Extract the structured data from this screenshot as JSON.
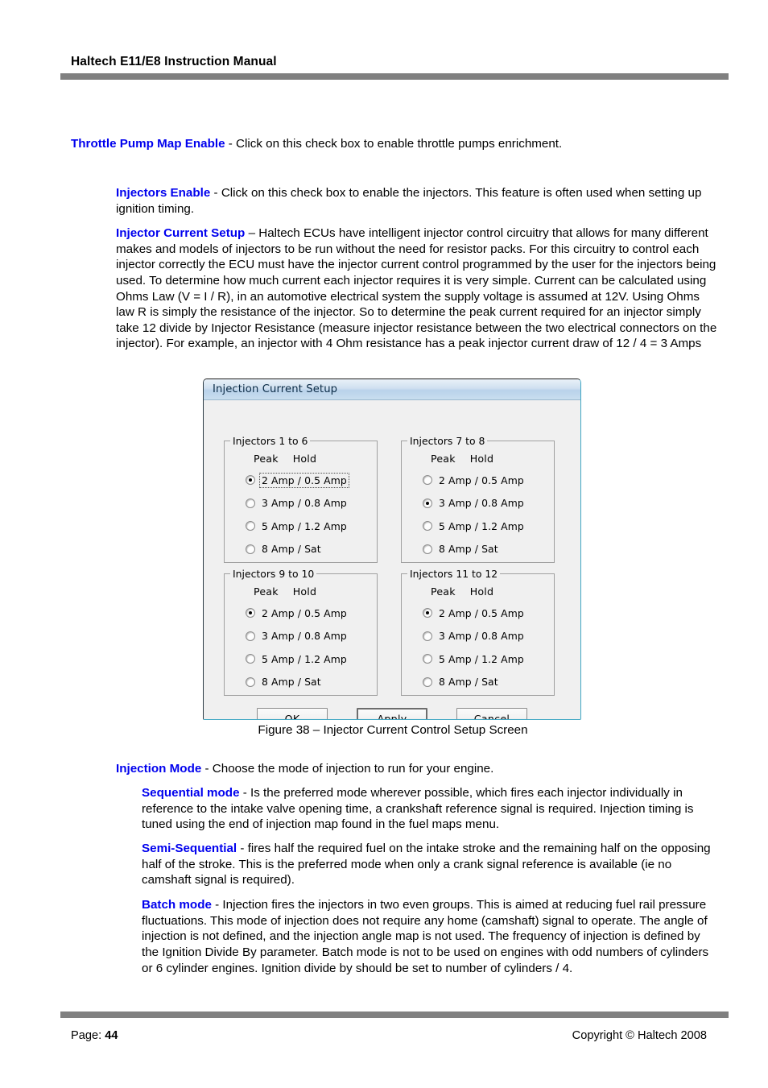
{
  "header": {
    "title": "Haltech E11/E8 Instruction Manual"
  },
  "body": {
    "throttle_pump": {
      "lead": "Throttle Pump Map Enable",
      "text": " - Click on this check box to enable throttle pumps enrichment."
    },
    "injectors_enable": {
      "lead": "Injectors Enable",
      "text": " - Click on this check box to enable the injectors. This feature is often used when setting up ignition timing."
    },
    "injector_current_setup": {
      "lead": "Injector Current Setup",
      "text": " – Haltech ECUs have intelligent injector control circuitry that allows for many different makes and models of injectors to be run without the need for resistor packs. For this circuitry to control each injector correctly the ECU must have the injector current control programmed by the user for the injectors being used. To determine how much current each injector requires it is very simple. Current can be calculated using Ohms Law (V = I / R), in an automotive electrical system the supply voltage is assumed at 12V. Using Ohms law R is simply the resistance of the injector. So to determine the peak current required for an injector simply take 12 divide by Injector Resistance (measure injector resistance between the two electrical connectors on the injector). For example, an injector with 4 Ohm resistance has a peak injector current draw of 12 / 4 = 3 Amps"
    },
    "injection_mode": {
      "lead": "Injection Mode",
      "text": " - Choose the mode of injection to run for your engine."
    },
    "sequential_mode": {
      "lead": "Sequential mode",
      "text": " - Is the preferred mode wherever possible, which fires each injector individually in reference to the intake valve opening time, a crankshaft reference signal is required. Injection timing is tuned using the end of injection map found in the fuel maps menu."
    },
    "semi_sequential": {
      "lead": "Semi-Sequential",
      "text": " -  fires half the required fuel on the intake stroke and the remaining half on the opposing half of the stroke. This is the preferred mode when only a crank signal reference is available (ie no camshaft signal is required)."
    },
    "batch_mode": {
      "lead": "Batch mode",
      "text": " - Injection fires the injectors in two even groups. This is aimed at reducing fuel rail pressure fluctuations. This mode of injection does not require any home (camshaft) signal to operate. The angle of injection is not defined, and the injection angle map is not used. The frequency of injection is defined by the Ignition Divide By parameter. Batch mode is not to be used on engines with odd numbers of cylinders or 6 cylinder engines. Ignition divide by should be set to number of cylinders / 4."
    }
  },
  "figure": {
    "caption": "Figure 38 – Injector Current Control Setup Screen",
    "dialog": {
      "title": "Injection Current Setup",
      "column_headers": {
        "peak": "Peak",
        "hold": "Hold"
      },
      "groups": [
        {
          "title": "Injectors 1 to 6",
          "selected_index": 0,
          "focused_index": 0,
          "options": [
            "2 Amp /  0.5 Amp",
            "3 Amp /  0.8 Amp",
            "5 Amp /  1.2 Amp",
            "8 Amp /  Sat"
          ]
        },
        {
          "title": "Injectors 7 to 8",
          "selected_index": 1,
          "focused_index": -1,
          "options": [
            "2 Amp /  0.5 Amp",
            "3 Amp /  0.8 Amp",
            "5 Amp /  1.2 Amp",
            "8 Amp /  Sat"
          ]
        },
        {
          "title": "Injectors 9 to 10",
          "selected_index": 0,
          "focused_index": -1,
          "options": [
            "2 Amp /  0.5 Amp",
            "3 Amp /  0.8 Amp",
            "5 Amp /  1.2 Amp",
            "8 Amp /  Sat"
          ]
        },
        {
          "title": "Injectors 11 to 12",
          "selected_index": 0,
          "focused_index": -1,
          "options": [
            "2 Amp /  0.5 Amp",
            "3 Amp /  0.8 Amp",
            "5 Amp /  1.2 Amp",
            "8 Amp /  Sat"
          ]
        }
      ],
      "buttons": [
        {
          "label": "OK",
          "default": false
        },
        {
          "label": "Apply",
          "default": true
        },
        {
          "label": "Cancel",
          "default": false
        }
      ]
    }
  },
  "footer": {
    "page_label": "Page: ",
    "page_number": "44",
    "copyright": "Copyright © Haltech 2008"
  },
  "colors": {
    "lead_blue": "#0000ee",
    "rule_gray": "#808080",
    "dialog_face": "#f0f0f0",
    "title_blue": "#0b2b46"
  }
}
